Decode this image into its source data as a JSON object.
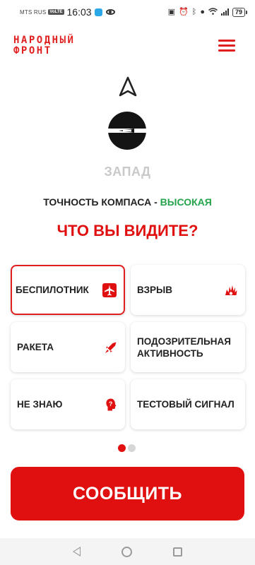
{
  "status_bar": {
    "carrier": "MTS RUS",
    "volte": "VoLTE",
    "time": "16:03",
    "battery": "79"
  },
  "header": {
    "logo_line1": "НАРОДНЫЙ",
    "logo_line2": "ФРОНТ"
  },
  "compass": {
    "direction": "ЗАПАД",
    "accuracy_label": "ТОЧНОСТЬ КОМПАСА - ",
    "accuracy_value": "ВЫСОКАЯ"
  },
  "question": "ЧТО ВЫ ВИДИТЕ?",
  "options": [
    {
      "label": "БЕСПИЛОТНИК",
      "icon": "airplane-icon",
      "selected": true
    },
    {
      "label": "ВЗРЫВ",
      "icon": "explosion-icon",
      "selected": false
    },
    {
      "label": "РАКЕТА",
      "icon": "rocket-icon",
      "selected": false
    },
    {
      "label": "ПОДОЗРИТЕЛЬНАЯ АКТИВНОСТЬ",
      "icon": "",
      "selected": false
    },
    {
      "label": "НЕ ЗНАЮ",
      "icon": "question-head-icon",
      "selected": false
    },
    {
      "label": "ТЕСТОВЫЙ СИГНАЛ",
      "icon": "",
      "selected": false
    }
  ],
  "pagination": {
    "pages": 2,
    "current": 1
  },
  "report_button": "СООБЩИТЬ",
  "colors": {
    "brand_red": "#e01010",
    "accuracy_green": "#23a34a",
    "direction_gray": "#c9c9c9"
  }
}
